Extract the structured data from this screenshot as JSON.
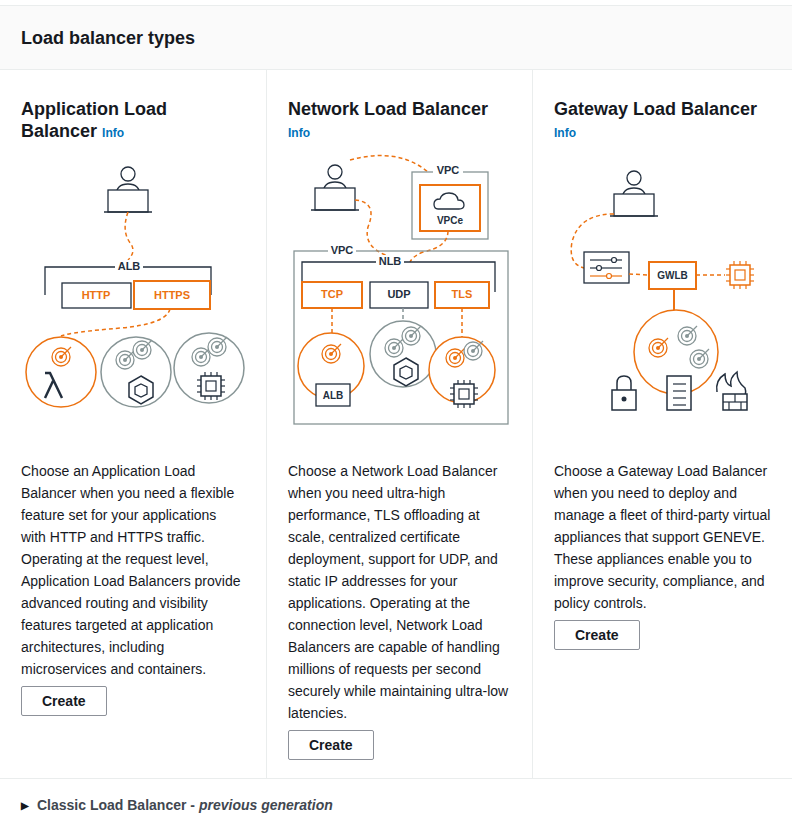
{
  "header": {
    "title": "Load balancer types"
  },
  "cards": [
    {
      "kind": "alb",
      "title": "Application Load Balancer",
      "info": "Info",
      "labels": {
        "alb": "ALB",
        "http": "HTTP",
        "https": "HTTPS"
      },
      "description": "Choose an Application Load Balancer when you need a flexible feature set for your applications with HTTP and HTTPS traffic. Operating at the request level, Application Load Balancers provide advanced routing and visibility features targeted at application architectures, including microservices and containers.",
      "button": "Create"
    },
    {
      "kind": "nlb",
      "title": "Network Load Balancer",
      "info": "Info",
      "labels": {
        "vpc_outer": "VPC",
        "vpce": "VPCe",
        "vpc": "VPC",
        "nlb": "NLB",
        "tcp": "TCP",
        "udp": "UDP",
        "tls": "TLS",
        "alb": "ALB"
      },
      "description": "Choose a Network Load Balancer when you need ultra-high performance, TLS offloading at scale, centralized certificate deployment, support for UDP, and static IP addresses for your applications. Operating at the connection level, Network Load Balancers are capable of handling millions of requests per second securely while maintaining ultra-low latencies.",
      "button": "Create"
    },
    {
      "kind": "gwlb",
      "title": "Gateway Load Balancer",
      "info": "Info",
      "labels": {
        "gwlb": "GWLB"
      },
      "description": "Choose a Gateway Load Balancer when you need to deploy and manage a fleet of third-party virtual appliances that support GENEVE. These appliances enable you to improve security, compliance, and policy controls.",
      "button": "Create"
    }
  ],
  "footer": {
    "toggle": "▶",
    "label": "Classic Load Balancer -",
    "emphasis": "previous generation",
    "expanded": false
  }
}
